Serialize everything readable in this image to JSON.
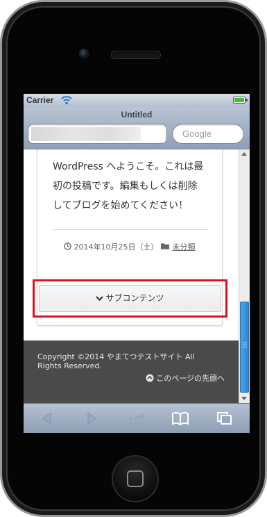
{
  "status_bar": {
    "carrier": "Carrier",
    "battery_level": 1.0,
    "battery_color": "#3ec23e"
  },
  "browser": {
    "title": "Untitled",
    "search_placeholder": "Google"
  },
  "post": {
    "lines": [
      "WordPress へようこそ。これは最",
      "初の投稿です。編集もしくは削除",
      "してブログを始めてください！"
    ],
    "date": "2014年10月25日（土）",
    "category": "未分類"
  },
  "sub_content": {
    "label": "サブコンテンツ",
    "highlight_color": "#e0101a"
  },
  "footer": {
    "copyright": "Copyright ©2014 やまてつテストサイト All Rights Reserved.",
    "page_top_label": "このページの先頭へ"
  },
  "icons": [
    "wifi-icon",
    "battery-icon",
    "clock-icon",
    "folder-icon",
    "chevron-down-icon",
    "up-circle-icon",
    "back-icon",
    "forward-icon",
    "share-icon",
    "bookmarks-icon",
    "tabs-icon"
  ]
}
